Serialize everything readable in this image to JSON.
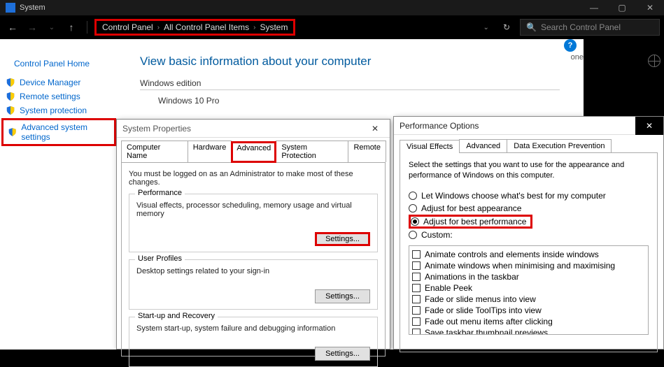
{
  "titlebar": {
    "title": "System"
  },
  "breadcrumb": {
    "items": [
      "Control Panel",
      "All Control Panel Items",
      "System"
    ]
  },
  "search": {
    "placeholder": "Search Control Panel"
  },
  "sidebar": {
    "home": "Control Panel Home",
    "items": [
      {
        "label": "Device Manager"
      },
      {
        "label": "Remote settings"
      },
      {
        "label": "System protection"
      },
      {
        "label": "Advanced system settings"
      }
    ]
  },
  "content": {
    "heading": "View basic information about your computer",
    "edition_header": "Windows edition",
    "edition_value": "Windows 10 Pro",
    "help_badge_text": "one"
  },
  "sysprop": {
    "title": "System Properties",
    "tabs": [
      "Computer Name",
      "Hardware",
      "Advanced",
      "System Protection",
      "Remote"
    ],
    "note": "You must be logged on as an Administrator to make most of these changes.",
    "groups": {
      "perf": {
        "legend": "Performance",
        "desc": "Visual effects, processor scheduling, memory usage and virtual memory",
        "button": "Settings..."
      },
      "user": {
        "legend": "User Profiles",
        "desc": "Desktop settings related to your sign-in",
        "button": "Settings..."
      },
      "startup": {
        "legend": "Start-up and Recovery",
        "desc": "System start-up, system failure and debugging information",
        "button": "Settings..."
      }
    }
  },
  "perfopt": {
    "title": "Performance Options",
    "tabs": [
      "Visual Effects",
      "Advanced",
      "Data Execution Prevention"
    ],
    "note": "Select the settings that you want to use for the appearance and performance of Windows on this computer.",
    "radios": [
      "Let Windows choose what's best for my computer",
      "Adjust for best appearance",
      "Adjust for best performance",
      "Custom:"
    ],
    "checks": [
      "Animate controls and elements inside windows",
      "Animate windows when minimising and maximising",
      "Animations in the taskbar",
      "Enable Peek",
      "Fade or slide menus into view",
      "Fade or slide ToolTips into view",
      "Fade out menu items after clicking",
      "Save taskbar thumbnail previews"
    ]
  }
}
